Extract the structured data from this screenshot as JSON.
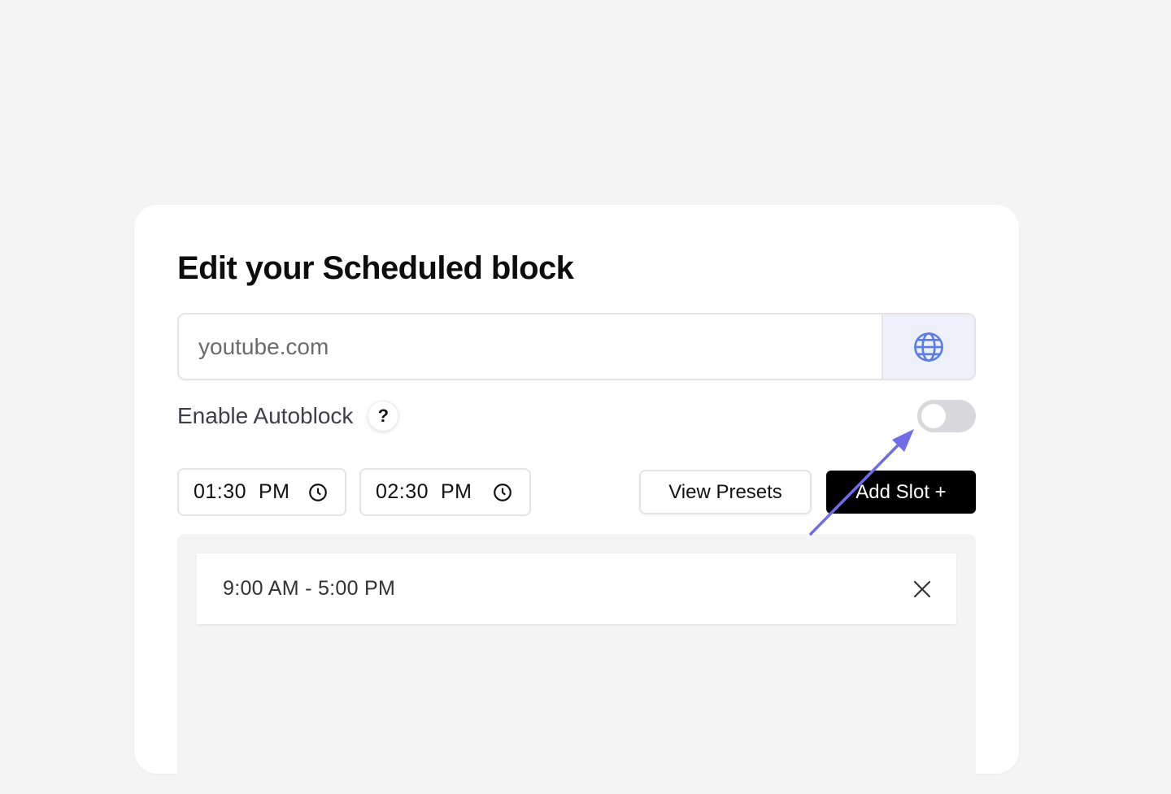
{
  "dialog": {
    "title": "Edit your Scheduled block"
  },
  "url_field": {
    "placeholder": "youtube.com",
    "icon": "globe-icon"
  },
  "autoblock": {
    "label": "Enable Autoblock",
    "help_label": "?",
    "enabled": false
  },
  "time_range": {
    "start": "01:30  PM",
    "end": "02:30  PM",
    "icon": "clock-icon"
  },
  "buttons": {
    "view_presets": "View Presets",
    "add_slot": "Add Slot +"
  },
  "slots": [
    {
      "label": "9:00 AM - 5:00 PM"
    }
  ],
  "colors": {
    "accent": "#5b7be6",
    "annotation_arrow": "#6f6ee8",
    "primary_button": "#000000",
    "toggle_off": "#d8d8dc"
  }
}
